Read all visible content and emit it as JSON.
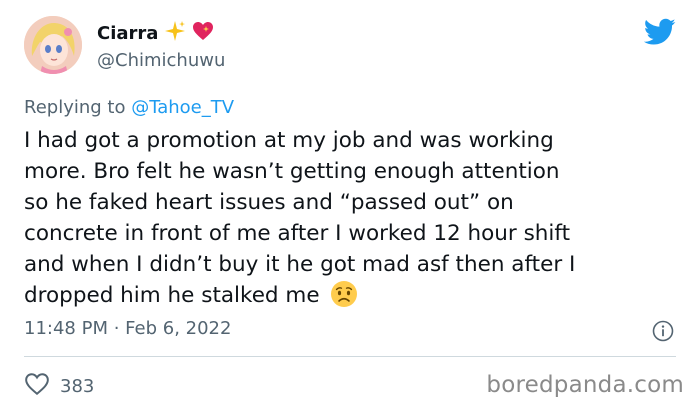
{
  "author": {
    "name": "Ciarra",
    "handle": "@Chimichuwu"
  },
  "icons": {
    "avatar": "anime-avatar",
    "name_emojis": [
      "sparkles-icon",
      "sparkling-heart-icon"
    ],
    "brand": "twitter-bird-icon",
    "info": "info-icon",
    "like": "heart-outline-icon",
    "inline_emoji": "worried-face-emoji"
  },
  "reply": {
    "prefix": "Replying to",
    "to": "@Tahoe_TV"
  },
  "tweet": {
    "lines": [
      "I had got a promotion at my job and was working",
      "more. Bro felt he wasn’t getting enough attention",
      "so he faked heart issues and “passed out” on",
      "concrete in front of me after I worked 12 hour shift",
      "and when I didn’t buy it he got mad asf then after I",
      "dropped him he stalked me"
    ]
  },
  "meta": {
    "time": "11:48 PM · Feb 6, 2022"
  },
  "likes": {
    "count": "383"
  },
  "watermark": "boredpanda.com",
  "colors": {
    "twitter_blue": "#1d9bf0",
    "muted": "#536471",
    "heart": "#e0245e"
  }
}
